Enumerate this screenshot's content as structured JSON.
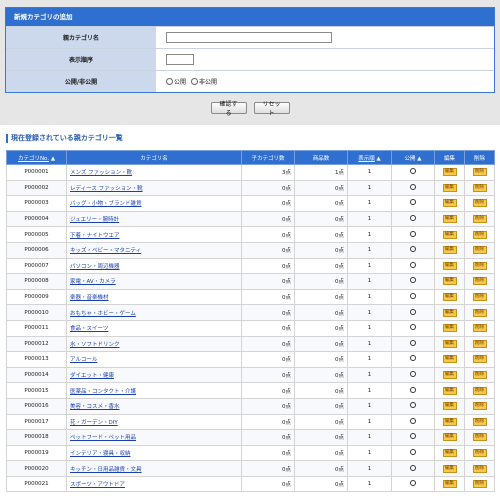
{
  "form": {
    "title": "新規カテゴリの追加",
    "parent_name_label": "親カテゴリ名",
    "parent_name_value": "",
    "order_label": "表示順序",
    "order_value": "",
    "visibility_label": "公開/非公開",
    "public_label": "公開",
    "private_label": "非公開",
    "confirm_label": "確認する",
    "reset_label": "リセット"
  },
  "list": {
    "heading": "現在登録されている親カテゴリ一覧",
    "columns": {
      "code": "カテゴリNo.",
      "name": "カテゴリ名",
      "children": "子カテゴリ数",
      "items": "商品数",
      "order": "表示順",
      "public": "公開",
      "edit": "編集",
      "delete": "削除"
    },
    "edit_btn": "編集",
    "delete_btn": "削除",
    "public_mark": "○",
    "rows": [
      {
        "code": "P000001",
        "name": "メンズ ファッション・靴",
        "children": "3点",
        "items": "1点",
        "order": "1"
      },
      {
        "code": "P000002",
        "name": "レディース ファッション・靴",
        "children": "0点",
        "items": "0点",
        "order": "1"
      },
      {
        "code": "P000003",
        "name": "バッグ・小物・ブランド雑貨",
        "children": "0点",
        "items": "0点",
        "order": "1"
      },
      {
        "code": "P000004",
        "name": "ジュエリー・腕時計",
        "children": "0点",
        "items": "0点",
        "order": "1"
      },
      {
        "code": "P000005",
        "name": "下着・ナイトウエア",
        "children": "0点",
        "items": "0点",
        "order": "1"
      },
      {
        "code": "P000006",
        "name": "キッズ・ベビー・マタニティ",
        "children": "0点",
        "items": "0点",
        "order": "1"
      },
      {
        "code": "P000007",
        "name": "パソコン・周辺機器",
        "children": "0点",
        "items": "0点",
        "order": "1"
      },
      {
        "code": "P000008",
        "name": "家電・AV・カメラ",
        "children": "0点",
        "items": "0点",
        "order": "1"
      },
      {
        "code": "P000009",
        "name": "楽器・音楽機材",
        "children": "0点",
        "items": "0点",
        "order": "1"
      },
      {
        "code": "P000010",
        "name": "おもちゃ・ホビー・ゲーム",
        "children": "0点",
        "items": "0点",
        "order": "1"
      },
      {
        "code": "P000011",
        "name": "食品・スイーツ",
        "children": "0点",
        "items": "0点",
        "order": "1"
      },
      {
        "code": "P000012",
        "name": "水・ソフトドリンク",
        "children": "0点",
        "items": "0点",
        "order": "1"
      },
      {
        "code": "P000013",
        "name": "アルコール",
        "children": "0点",
        "items": "0点",
        "order": "1"
      },
      {
        "code": "P000014",
        "name": "ダイエット・健康",
        "children": "0点",
        "items": "0点",
        "order": "1"
      },
      {
        "code": "P000015",
        "name": "医薬品・コンタクト・介護",
        "children": "0点",
        "items": "0点",
        "order": "1"
      },
      {
        "code": "P000016",
        "name": "美容・コスメ・香水",
        "children": "0点",
        "items": "0点",
        "order": "1"
      },
      {
        "code": "P000017",
        "name": "花・ガーデン・DIY",
        "children": "0点",
        "items": "0点",
        "order": "1"
      },
      {
        "code": "P000018",
        "name": "ペットフード・ペット用品",
        "children": "0点",
        "items": "0点",
        "order": "1"
      },
      {
        "code": "P000019",
        "name": "インテリア・寝具・収納",
        "children": "0点",
        "items": "0点",
        "order": "1"
      },
      {
        "code": "P000020",
        "name": "キッチン・日用品雑貨・文具",
        "children": "0点",
        "items": "0点",
        "order": "1"
      },
      {
        "code": "P000021",
        "name": "スポーツ・アウトドア",
        "children": "0点",
        "items": "0点",
        "order": "1"
      }
    ]
  }
}
